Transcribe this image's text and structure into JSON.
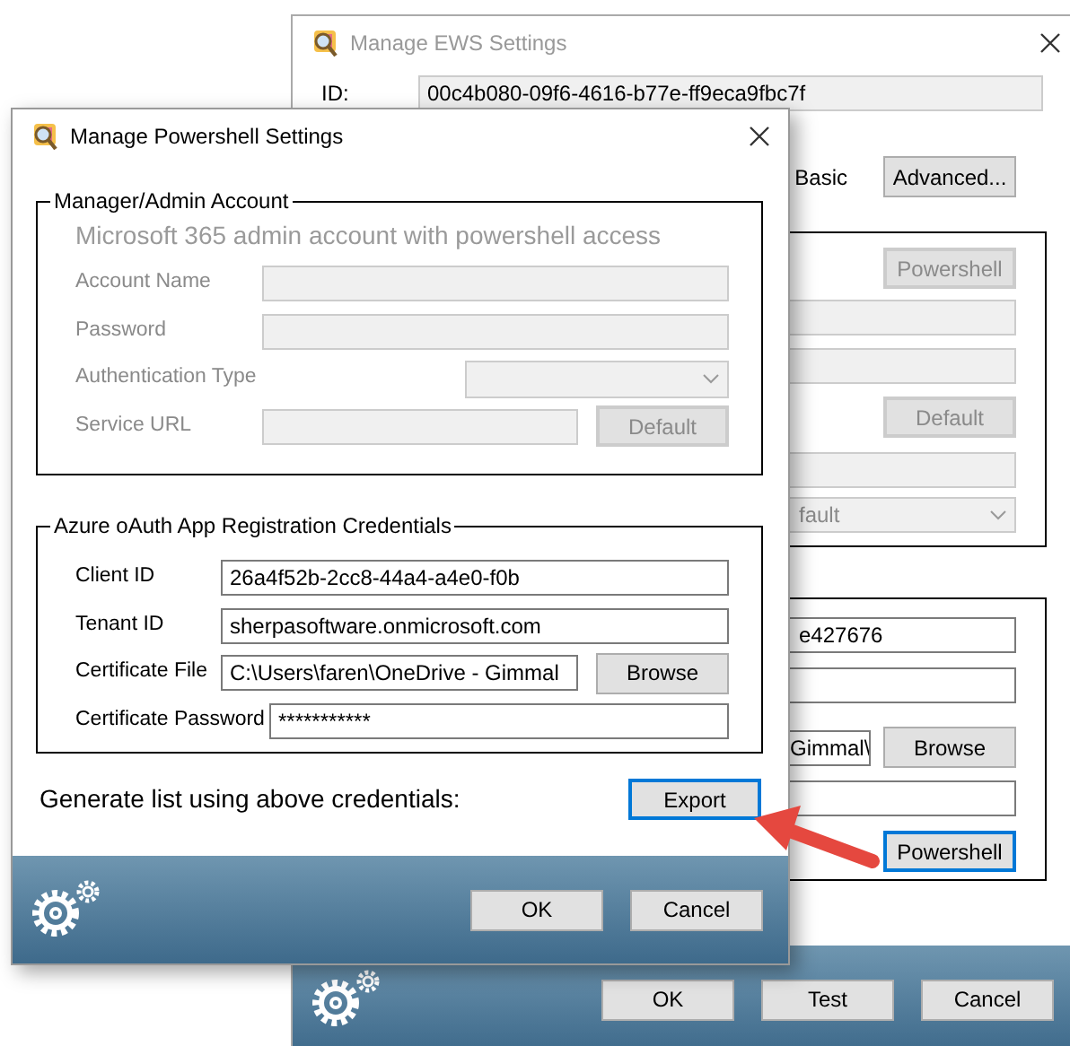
{
  "ews_window": {
    "title": "Manage EWS Settings",
    "active": false,
    "id_label": "ID:",
    "id_value": "00c4b080-09f6-4616-b77e-ff9eca9fbc7f",
    "auth_label": "Basic",
    "advanced_button": "Advanced...",
    "server_group": {
      "powershell_button": {
        "label": "Powershell",
        "disabled": true
      },
      "default_button": {
        "label": "Default",
        "disabled": true
      },
      "dropdown_value": "fault"
    },
    "credentials_group": {
      "client_value": "e427676",
      "file_value": "Gimmal\\",
      "browse_button": "Browse",
      "powershell_button": {
        "label": "Powershell",
        "focused": true
      }
    },
    "buttons": [
      "OK",
      "Test",
      "Cancel"
    ]
  },
  "powershell_window": {
    "title": "Manage Powershell Settings",
    "active": true,
    "admin_group": {
      "legend": "Manager/Admin Account",
      "heading": "Microsoft 365 admin account with powershell access",
      "disabled": true,
      "fields": [
        {
          "label": "Account Name",
          "kind": "text"
        },
        {
          "label": "Password",
          "kind": "text"
        },
        {
          "label": "Authentication Type",
          "kind": "dropdown"
        },
        {
          "label": "Service URL",
          "kind": "text_button",
          "button": "Default"
        }
      ]
    },
    "azure_group": {
      "legend": "Azure oAuth App Registration Credentials",
      "disabled": false,
      "fields": [
        {
          "label": "Client ID",
          "kind": "text",
          "value": "26a4f52b-2cc8-44a4-a4e0-f0b"
        },
        {
          "label": "Tenant ID",
          "kind": "text",
          "value": "sherpasoftware.onmicrosoft.com"
        },
        {
          "label": "Certificate File",
          "kind": "text_button",
          "value": "C:\\Users\\faren\\OneDrive - Gimmal",
          "button": "Browse"
        },
        {
          "label": "Certificate Password",
          "kind": "password",
          "value": "***********"
        }
      ]
    },
    "export_prompt": "Generate list using above credentials:",
    "export_button": {
      "label": "Export",
      "focused": true
    },
    "buttons": [
      "OK",
      "Cancel"
    ]
  }
}
